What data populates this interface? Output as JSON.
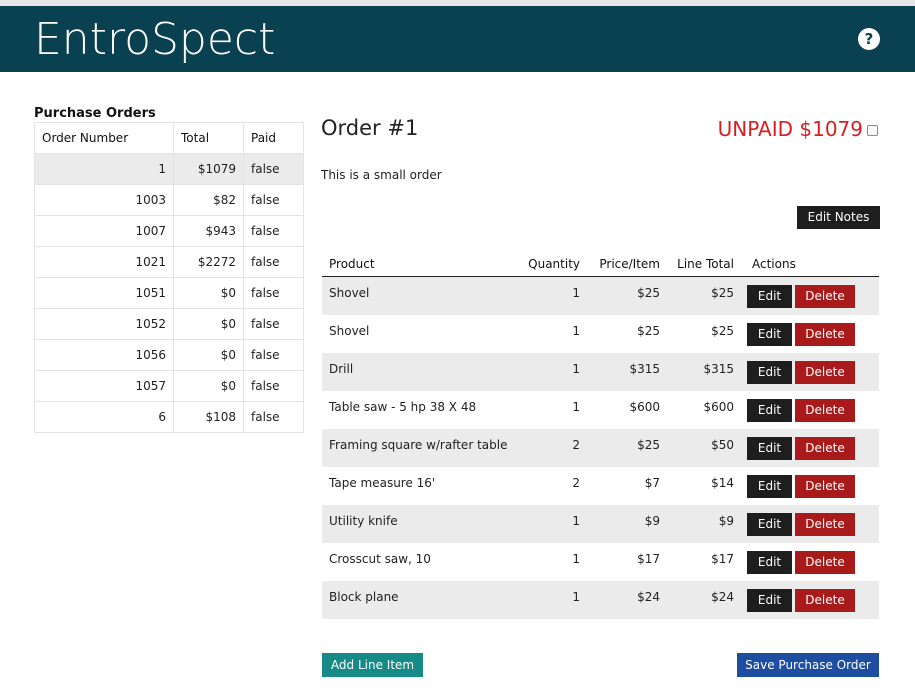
{
  "app": {
    "brand": "EntroSpect",
    "help_icon": "question-circle-icon",
    "help_glyph": "?"
  },
  "sidebar": {
    "title": "Purchase Orders",
    "columns": [
      "Order Number",
      "Total",
      "Paid"
    ],
    "rows": [
      {
        "number": "1",
        "total": "$1079",
        "paid": "false",
        "selected": true
      },
      {
        "number": "1003",
        "total": "$82",
        "paid": "false"
      },
      {
        "number": "1007",
        "total": "$943",
        "paid": "false"
      },
      {
        "number": "1021",
        "total": "$2272",
        "paid": "false"
      },
      {
        "number": "1051",
        "total": "$0",
        "paid": "false"
      },
      {
        "number": "1052",
        "total": "$0",
        "paid": "false"
      },
      {
        "number": "1056",
        "total": "$0",
        "paid": "false"
      },
      {
        "number": "1057",
        "total": "$0",
        "paid": "false"
      },
      {
        "number": "6",
        "total": "$108",
        "paid": "false"
      }
    ]
  },
  "order": {
    "title": "Order #1",
    "status": "UNPAID $1079",
    "notes": "This is a small order",
    "edit_notes_label": "Edit Notes",
    "columns": {
      "product": "Product",
      "quantity": "Quantity",
      "price": "Price/Item",
      "total": "Line Total",
      "actions": "Actions"
    },
    "edit_label": "Edit",
    "delete_label": "Delete",
    "lines": [
      {
        "product": "Shovel",
        "quantity": "1",
        "price": "$25",
        "total": "$25"
      },
      {
        "product": "Shovel",
        "quantity": "1",
        "price": "$25",
        "total": "$25"
      },
      {
        "product": "Drill",
        "quantity": "1",
        "price": "$315",
        "total": "$315"
      },
      {
        "product": "Table saw - 5 hp 38 X 48",
        "quantity": "1",
        "price": "$600",
        "total": "$600"
      },
      {
        "product": "Framing square w/rafter table",
        "quantity": "2",
        "price": "$25",
        "total": "$50"
      },
      {
        "product": "Tape measure 16'",
        "quantity": "2",
        "price": "$7",
        "total": "$14"
      },
      {
        "product": "Utility knife",
        "quantity": "1",
        "price": "$9",
        "total": "$9"
      },
      {
        "product": "Crosscut saw, 10",
        "quantity": "1",
        "price": "$17",
        "total": "$17"
      },
      {
        "product": "Block plane",
        "quantity": "1",
        "price": "$24",
        "total": "$24"
      }
    ],
    "add_line_label": "Add Line Item",
    "save_label": "Save Purchase Order"
  },
  "colors": {
    "header": "#0a4150",
    "unpaid": "#d81e1e",
    "delete": "#a91b1b",
    "add": "#158a86",
    "save": "#1d4ea1"
  }
}
